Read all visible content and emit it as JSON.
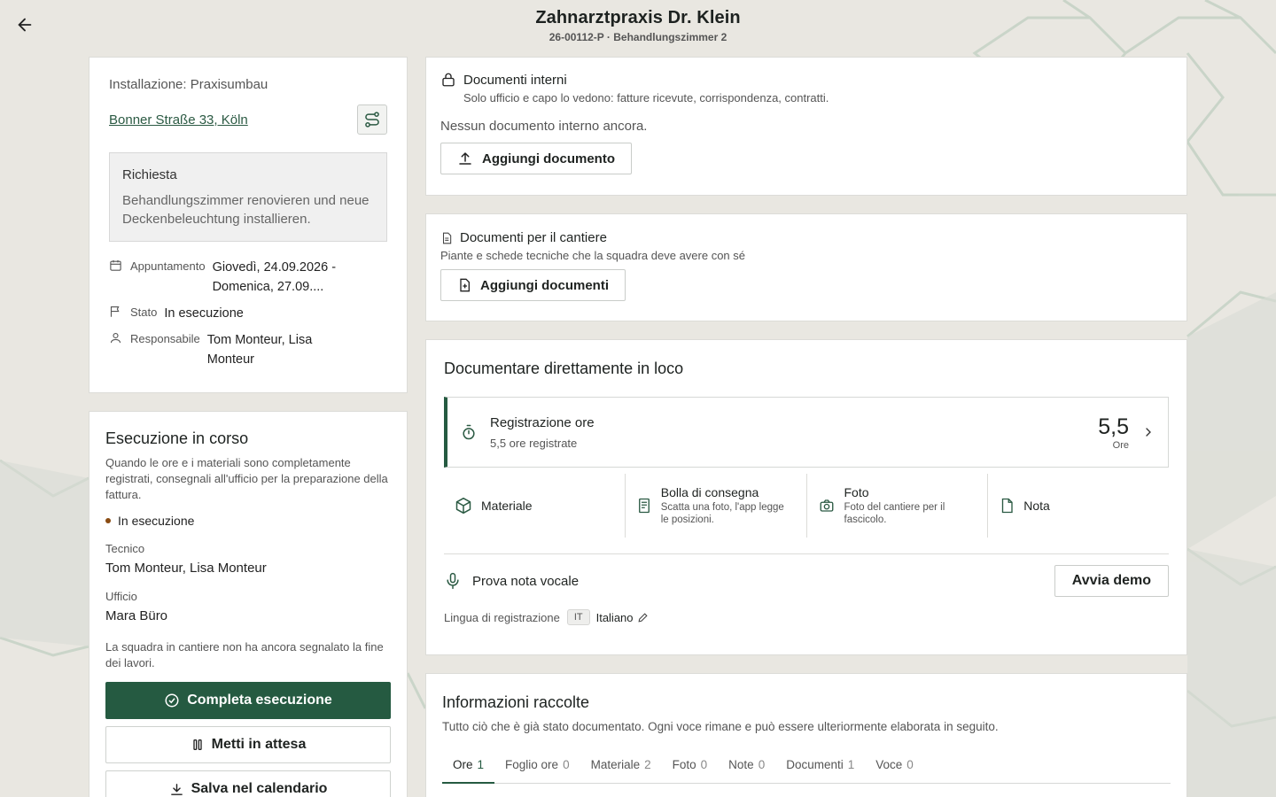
{
  "header": {
    "title": "Zahnarztpraxis Dr. Klein",
    "subtitle": "26-00112-P · Behandlungszimmer 2"
  },
  "site": {
    "installation": "Installazione: Praxisumbau",
    "address": "Bonner Straße 33, Köln",
    "request_title": "Richiesta",
    "request_text": "Behandlungszimmer renovieren und neue Deckenbeleuchtung installieren.",
    "appointment_label": "Appuntamento",
    "appointment_value": "Giovedì, 24.09.2026 - Domenica, 27.09....",
    "state_label": "Stato",
    "state_value": "In esecuzione",
    "responsible_label": "Responsabile",
    "responsible_value": "Tom Monteur, Lisa Monteur"
  },
  "execution": {
    "title": "Esecuzione in corso",
    "description": "Quando le ore e i materiali sono completamente registrati, consegnali all'ufficio per la preparazione della fattura.",
    "status": "In esecuzione",
    "status_color": "#8a4b12",
    "technician_label": "Tecnico",
    "technician_value": "Tom Monteur, Lisa Monteur",
    "office_label": "Ufficio",
    "office_value": "Mara Büro",
    "note": "La squadra in cantiere non ha ancora segnalato la fine dei lavori.",
    "complete_button": "Completa esecuzione",
    "pause_button": "Metti in attesa",
    "calendar_button": "Salva nel calendario"
  },
  "internal_docs": {
    "title": "Documenti interni",
    "subtitle": "Solo ufficio e capo lo vedono: fatture ricevute, corrispondenza, contratti.",
    "empty": "Nessun documento interno ancora.",
    "add_button": "Aggiungi documento"
  },
  "site_docs": {
    "title": "Documenti per il cantiere",
    "subtitle": "Piante e schede tecniche che la squadra deve avere con sé",
    "add_button": "Aggiungi documenti"
  },
  "onsite": {
    "title": "Documentare direttamente in loco",
    "hours_title": "Registrazione ore",
    "hours_sub": "5,5 ore registrate",
    "hours_value": "5,5",
    "hours_unit": "Ore",
    "tiles": [
      {
        "title": "Materiale",
        "sub": "",
        "icon": "package-icon"
      },
      {
        "title": "Bolla di consegna",
        "sub": "Scatta una foto, l'app legge le posizioni.",
        "icon": "receipt-icon"
      },
      {
        "title": "Foto",
        "sub": "Foto del cantiere per il fascicolo.",
        "icon": "camera-icon"
      },
      {
        "title": "Nota",
        "sub": "",
        "icon": "note-icon"
      }
    ],
    "voice_label": "Prova nota vocale",
    "demo_button": "Avvia demo",
    "lang_label": "Lingua di registrazione",
    "lang_code": "IT",
    "lang_value": "Italiano"
  },
  "info": {
    "title": "Informazioni raccolte",
    "description": "Tutto ciò che è già stato documentato. Ogni voce rimane e può essere ulteriormente elaborata in seguito.",
    "tabs": [
      {
        "label": "Ore",
        "count": "1"
      },
      {
        "label": "Foglio ore",
        "count": "0"
      },
      {
        "label": "Materiale",
        "count": "2"
      },
      {
        "label": "Foto",
        "count": "0"
      },
      {
        "label": "Note",
        "count": "0"
      },
      {
        "label": "Documenti",
        "count": "1"
      },
      {
        "label": "Voce",
        "count": "0"
      }
    ]
  },
  "colors": {
    "accent": "#255a41",
    "background": "#e9e7e1"
  }
}
